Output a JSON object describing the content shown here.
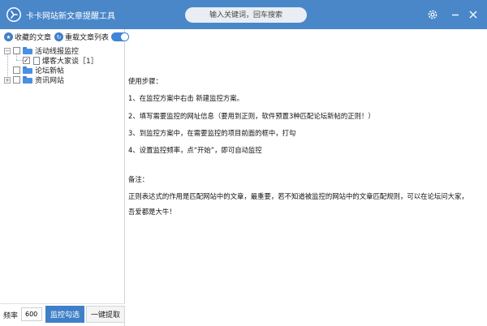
{
  "app": {
    "title": "卡卡网站新文章提醒工具",
    "search_placeholder": "输入关键词，回车搜索"
  },
  "sidebar": {
    "toolbar": {
      "favorites_label": "收藏的文章",
      "reload_label": "重载文章列表",
      "toggle_on": true
    },
    "tree": [
      {
        "label": "活动线报监控",
        "level": 0,
        "expanded": true,
        "checked": false
      },
      {
        "label": "爆客大家谈［1］",
        "level": 1,
        "checked": true
      },
      {
        "label": "论坛新帖",
        "level": 0,
        "expanded": false,
        "checked": false
      },
      {
        "label": "资讯网站",
        "level": 0,
        "expanded": false,
        "checked": false
      }
    ]
  },
  "bottom": {
    "freq_label": "频率",
    "freq_value": "600",
    "monitor_button": "监控勾选",
    "extract_button": "一键提取"
  },
  "content": {
    "lines": [
      "使用步骤：",
      "1、在监控方案中右击  新建监控方案。",
      "2、填写需要监控的网址信息（要用到正则，软件预置3种匹配论坛新帖的正则！）",
      "3、到监控方案中，在需要监控的项目前面的框中，打勾",
      "4、设置监控频率，点“开始”，即可自动监控",
      "备注：",
      "正则表达式的作用是匹配网站中的文章，最重要，若不知道被监控的网站中的文章匹配规则，可以在论坛问大家，",
      "吾爱都是大牛！"
    ]
  },
  "colors": {
    "titlebar": "#4a87c9",
    "accent": "#3f7fc7",
    "folder": "#4a90e2"
  }
}
